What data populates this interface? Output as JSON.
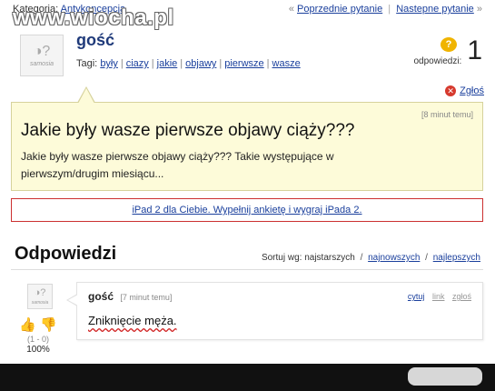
{
  "topbar": {
    "category_label": "Kategoria:",
    "category_link": "Antykoncepcja",
    "prev_link": "Poprzednie pytanie",
    "next_link": "Nastepne pytanie",
    "prev_arrow": "«",
    "next_arrow": "»",
    "separator": "|"
  },
  "watermark": "www.wiocha.pl",
  "question": {
    "avatar_brand": "samosia",
    "author": "gość",
    "tags_label": "Tagi:",
    "tags": [
      "były",
      "ciazy",
      "jakie",
      "objawy",
      "pierwsze",
      "wasze"
    ],
    "answers_label": "odpowiedzi:",
    "answers_count": "1",
    "answers_icon": "?",
    "report_label": "Zgłoś",
    "time": "[8 minut temu]",
    "title": "Jakie były wasze pierwsze objawy ciąży???",
    "body": "Jakie były wasze pierwsze objawy ciąży??? Takie występujące w pierwszym/drugim miesiącu..."
  },
  "ad": {
    "text": "iPad 2 dla Ciebie. Wypełnij ankietę i wygraj iPada 2."
  },
  "answers": {
    "title": "Odpowiedzi",
    "sort_label": "Sortuj wg:",
    "sort_current": "najstarszych",
    "sort_newest": "najnowszych",
    "sort_best": "najlepszych",
    "sort_sep": "/",
    "items": [
      {
        "avatar_brand": "samosia",
        "author": "gość",
        "time": "[7 minut temu]",
        "cite": "cytuj",
        "link": "link",
        "report": "zgłoś",
        "text": "Zniknięcie męża.",
        "votes": "(1 - 0)",
        "percent": "100%"
      }
    ]
  },
  "colors": {
    "link": "#1a3f9c",
    "question_bg": "#fdfbd9",
    "ad_border": "#cc3030",
    "report_icon": "#d63a2e",
    "answers_icon": "#f0b400"
  }
}
